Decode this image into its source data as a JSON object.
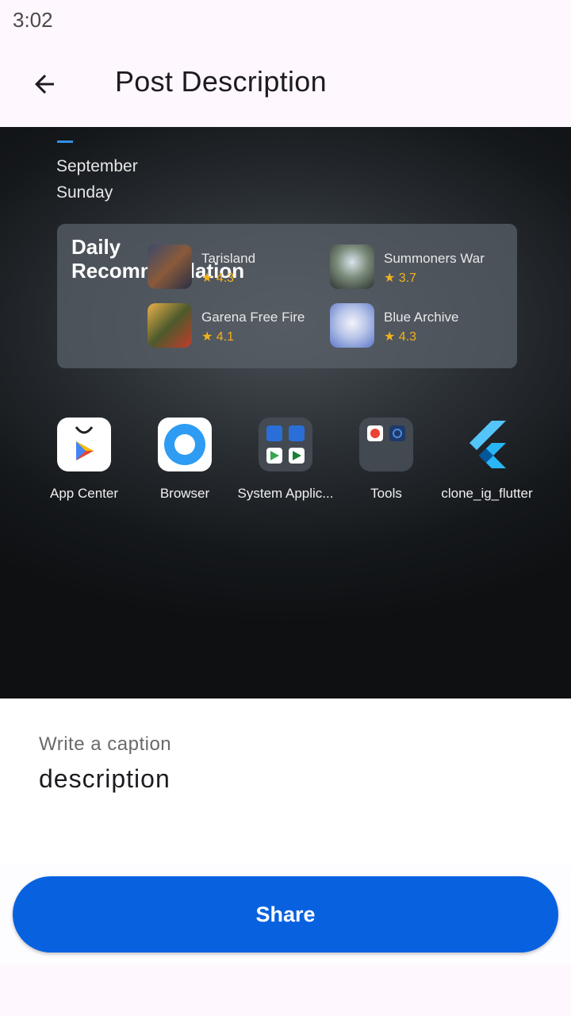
{
  "status_bar": {
    "time": "3:02"
  },
  "app_bar": {
    "title": "Post Description",
    "back_icon": "arrow-left-icon"
  },
  "preview": {
    "month": "September",
    "weekday": "Sunday",
    "recommendation": {
      "title": "Daily\nRecommendation",
      "games": [
        {
          "name": "Tarisland",
          "rating": "★ 4.3"
        },
        {
          "name": "Summoners War",
          "rating": "★ 3.7"
        },
        {
          "name": "Garena Free Fire",
          "rating": "★ 4.1"
        },
        {
          "name": "Blue Archive",
          "rating": "★ 4.3"
        }
      ]
    },
    "apps": [
      {
        "label": "App Center",
        "icon": "app-center-icon"
      },
      {
        "label": "Browser",
        "icon": "browser-icon"
      },
      {
        "label": "System Applic...",
        "icon": "system-apps-folder-icon"
      },
      {
        "label": "Tools",
        "icon": "tools-folder-icon"
      },
      {
        "label": "clone_ig_flutter",
        "icon": "flutter-icon"
      }
    ]
  },
  "caption": {
    "label": "Write a caption",
    "value": "description"
  },
  "share": {
    "label": "Share"
  },
  "colors": {
    "primary": "#0862e0",
    "rating": "#f3b21a"
  }
}
